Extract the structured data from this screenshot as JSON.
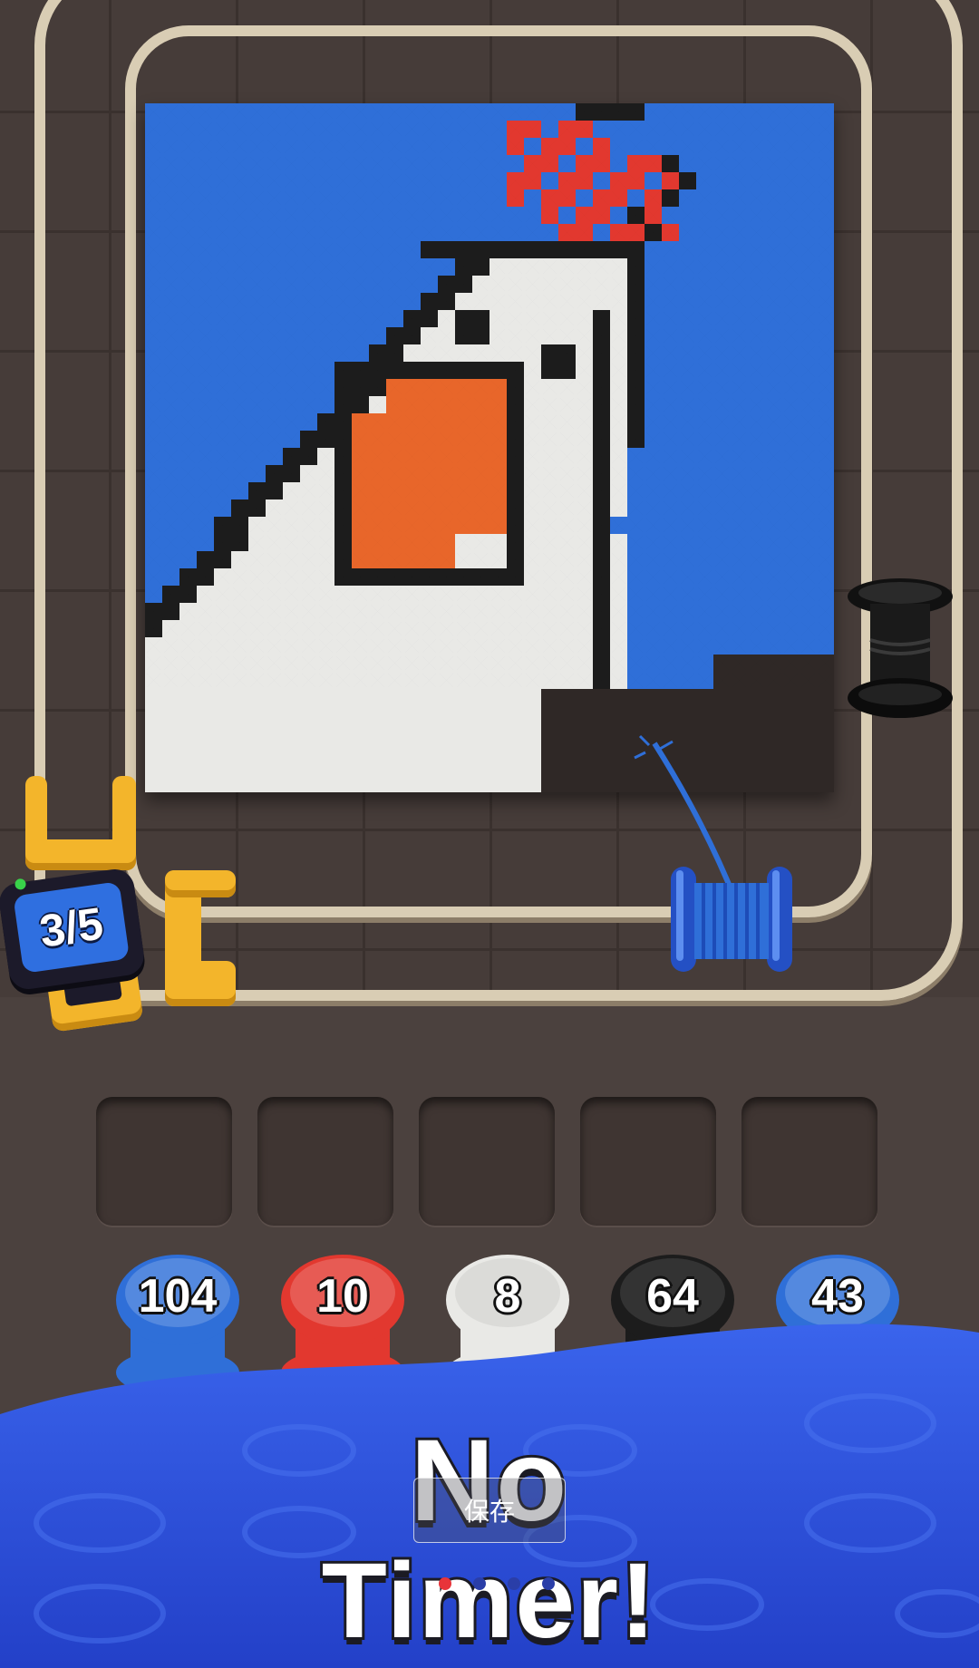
{
  "level": {
    "progress_text": "3/5",
    "current": 3,
    "total": 5
  },
  "canvas": {
    "colors": {
      "background": "#2f6fd8",
      "body": "#e9e9e6",
      "outline": "#1c1c1c",
      "comb": "#e2382f",
      "beak": "#e8662a",
      "cutoff": "#2f2826"
    }
  },
  "slots": {
    "count": 5,
    "items": [
      "",
      "",
      "",
      "",
      ""
    ]
  },
  "spools": [
    {
      "count": "104",
      "color": "#2f6fd8",
      "icon": "blue-spool-icon"
    },
    {
      "count": "10",
      "color": "#e2382f",
      "icon": "red-spool-icon"
    },
    {
      "count": "8",
      "color": "#e9e9e6",
      "icon": "white-spool-icon"
    },
    {
      "count": "64",
      "color": "#1c1c1c",
      "icon": "black-spool-icon"
    },
    {
      "count": "43",
      "color": "#2f6fd8",
      "icon": "blue-spool-icon"
    }
  ],
  "banner": {
    "line1": "No",
    "line2": "Timer!",
    "color": "#2d54e0"
  },
  "overlay": {
    "save_label": "保存"
  },
  "pagination": {
    "count": 4,
    "active_index": 0
  }
}
